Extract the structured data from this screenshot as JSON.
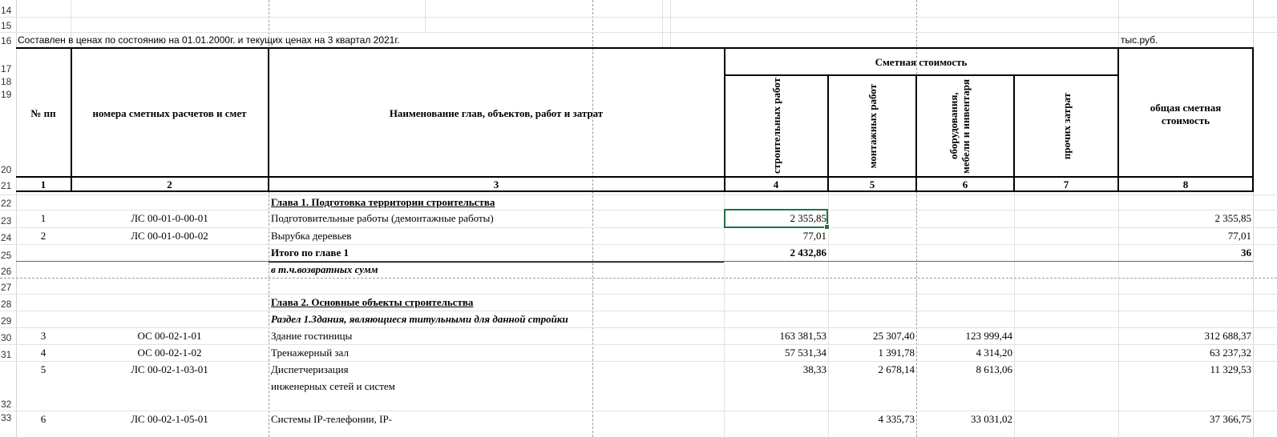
{
  "row_numbers": [
    "14",
    "15",
    "16",
    "17",
    "18",
    "19",
    "20",
    "21",
    "22",
    "23",
    "24",
    "25",
    "26",
    "27",
    "28",
    "29",
    "30",
    "31",
    "32",
    "33"
  ],
  "header_note": "Составлен в ценах по состоянию на 01.01.2000г. и текущих ценах на 3 квартал 2021г.",
  "units": "тыс.руб.",
  "columns": {
    "num": "№ пп",
    "estimate_numbers": "номера сметных расчетов и смет",
    "name": "Наименование глав, объектов, работ и затрат",
    "group": "Сметная стоимость",
    "construction": "строительных работ",
    "installation": "монтажных работ",
    "equipment": "оборудования, мебели и инвентаря",
    "other": "прочих затрат",
    "total": "общая сметная стоимость"
  },
  "column_numbers": [
    "1",
    "2",
    "3",
    "4",
    "5",
    "6",
    "7",
    "8"
  ],
  "rows": {
    "chapter1": "Глава 1. Подготовка территории строительства",
    "r1": {
      "num": "1",
      "code": "ЛС 00-01-0-00-01",
      "name": "Подготовительные работы (демонтажные работы)",
      "c4": "2 355,85",
      "c8": "2 355,85"
    },
    "r2": {
      "num": "2",
      "code": "ЛС 00-01-0-00-02",
      "name": "Вырубка деревьев",
      "c4": "77,01",
      "c8": "77,01"
    },
    "total1": {
      "name": "Итого по главе 1",
      "c4": "2 432,86",
      "c8": "36"
    },
    "refund1": "в т.ч.возвратных сумм",
    "chapter2": "Глава 2. Основные объекты строительства",
    "section1": "Раздел 1.Здания, являющиеся титульными для данной стройки",
    "r3": {
      "num": "3",
      "code": "ОС 00-02-1-01",
      "name": "Здание гостиницы",
      "c4": "163 381,53",
      "c5": "25 307,40",
      "c6": "123 999,44",
      "c8": "312 688,37"
    },
    "r4": {
      "num": "4",
      "code": "ОС 00-02-1-02",
      "name": "Тренажерный зал",
      "c4": "57 531,34",
      "c5": "1 391,78",
      "c6": "4 314,20",
      "c8": "63 237,32"
    },
    "r5": {
      "num": "5",
      "code": "ЛС 00-02-1-03-01",
      "name1": "Диспетчеризация",
      "name2": "инженерных сетей и систем",
      "c4": "38,33",
      "c5": "2 678,14",
      "c6": "8 613,06",
      "c8": "11 329,53"
    },
    "r6": {
      "num": "6",
      "code": "ЛС 00-02-1-05-01",
      "name": "Системы IP-телефонии, IP-",
      "c5": "4 335,73",
      "c6": "33 031,02",
      "c8": "37 366,75"
    }
  }
}
